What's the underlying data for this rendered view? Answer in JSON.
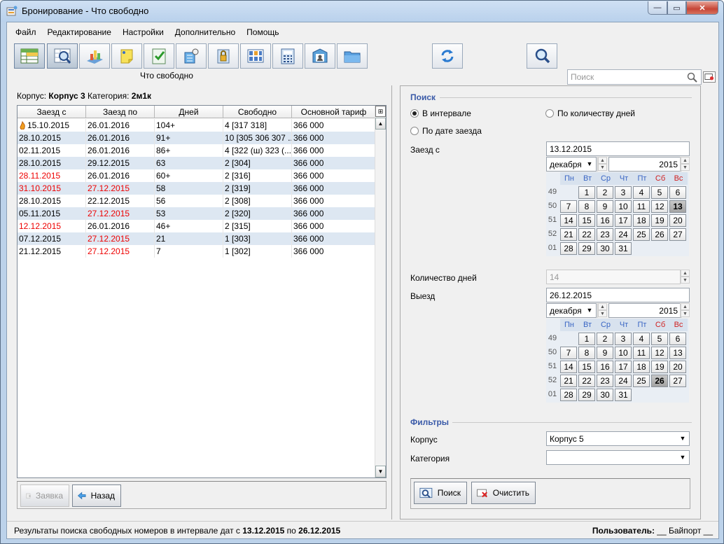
{
  "window": {
    "title": "Бронирование - Что свободно",
    "min": "—",
    "max": "▭",
    "close": "✕"
  },
  "menu": [
    "Файл",
    "Редактирование",
    "Настройки",
    "Дополнительно",
    "Помощь"
  ],
  "toolbar": {
    "caption": "Что свободно",
    "search_placeholder": "Поиск"
  },
  "left": {
    "info_prefix": "Корпус: ",
    "info_building": "Корпус 3",
    "info_mid": " Категория: ",
    "info_category": "2м1к",
    "columns": [
      "Заезд с",
      "Заезд по",
      "Дней",
      "Свободно",
      "Основной тариф"
    ],
    "rows": [
      {
        "from": "15.10.2015",
        "to": "26.01.2016",
        "days": "104+",
        "free": "4 [317 318]",
        "tariff": "366 000",
        "from_red": false,
        "to_red": false,
        "flag": true
      },
      {
        "from": "28.10.2015",
        "to": "26.01.2016",
        "days": "91+",
        "free": "10 [305 306 307 ...",
        "tariff": "366 000",
        "from_red": false,
        "to_red": false
      },
      {
        "from": "02.11.2015",
        "to": "26.01.2016",
        "days": "86+",
        "free": "4 [322 (ш) 323 (...",
        "tariff": "366 000",
        "from_red": false,
        "to_red": false
      },
      {
        "from": "28.10.2015",
        "to": "29.12.2015",
        "days": "63",
        "free": "2 [304]",
        "tariff": "366 000",
        "from_red": false,
        "to_red": false
      },
      {
        "from": "28.11.2015",
        "to": "26.01.2016",
        "days": "60+",
        "free": "2 [316]",
        "tariff": "366 000",
        "from_red": true,
        "to_red": false
      },
      {
        "from": "31.10.2015",
        "to": "27.12.2015",
        "days": "58",
        "free": "2 [319]",
        "tariff": "366 000",
        "from_red": true,
        "to_red": true
      },
      {
        "from": "28.10.2015",
        "to": "22.12.2015",
        "days": "56",
        "free": "2 [308]",
        "tariff": "366 000",
        "from_red": false,
        "to_red": false
      },
      {
        "from": "05.11.2015",
        "to": "27.12.2015",
        "days": "53",
        "free": "2 [320]",
        "tariff": "366 000",
        "from_red": false,
        "to_red": true
      },
      {
        "from": "12.12.2015",
        "to": "26.01.2016",
        "days": "46+",
        "free": "2 [315]",
        "tariff": "366 000",
        "from_red": true,
        "to_red": false
      },
      {
        "from": "07.12.2015",
        "to": "27.12.2015",
        "days": "21",
        "free": "1 [303]",
        "tariff": "366 000",
        "from_red": false,
        "to_red": true
      },
      {
        "from": "21.12.2015",
        "to": "27.12.2015",
        "days": "7",
        "free": "1 [302]",
        "tariff": "366 000",
        "from_red": false,
        "to_red": true
      }
    ],
    "btn_request": "Заявка",
    "btn_back": "Назад"
  },
  "right": {
    "search_title": "Поиск",
    "radio_interval": "В интервале",
    "radio_days": "По количеству дней",
    "radio_date": "По дате заезда",
    "checkin_label": "Заезд с",
    "checkin_value": "13.12.2015",
    "month": "декабря",
    "year": "2015",
    "weekdays": [
      "Пн",
      "Вт",
      "Ср",
      "Чт",
      "Пт",
      "Сб",
      "Вс"
    ],
    "weeks": [
      "49",
      "50",
      "51",
      "52",
      "01"
    ],
    "cal1_selected": "13",
    "days_label": "Количество дней",
    "days_value": "14",
    "checkout_label": "Выезд",
    "checkout_value": "26.12.2015",
    "cal2_selected": "26",
    "filters_title": "Фильтры",
    "building_label": "Корпус",
    "building_value": "Корпус 5",
    "category_label": "Категория",
    "category_value": "",
    "btn_search": "Поиск",
    "btn_clear": "Очистить"
  },
  "status": {
    "prefix": "Результаты поиска свободных номеров в интервале дат с ",
    "date_from": "13.12.2015",
    "mid": " по ",
    "date_to": "26.12.2015",
    "user_label": "Пользователь:",
    "user_value": " __ Байпорт __"
  }
}
